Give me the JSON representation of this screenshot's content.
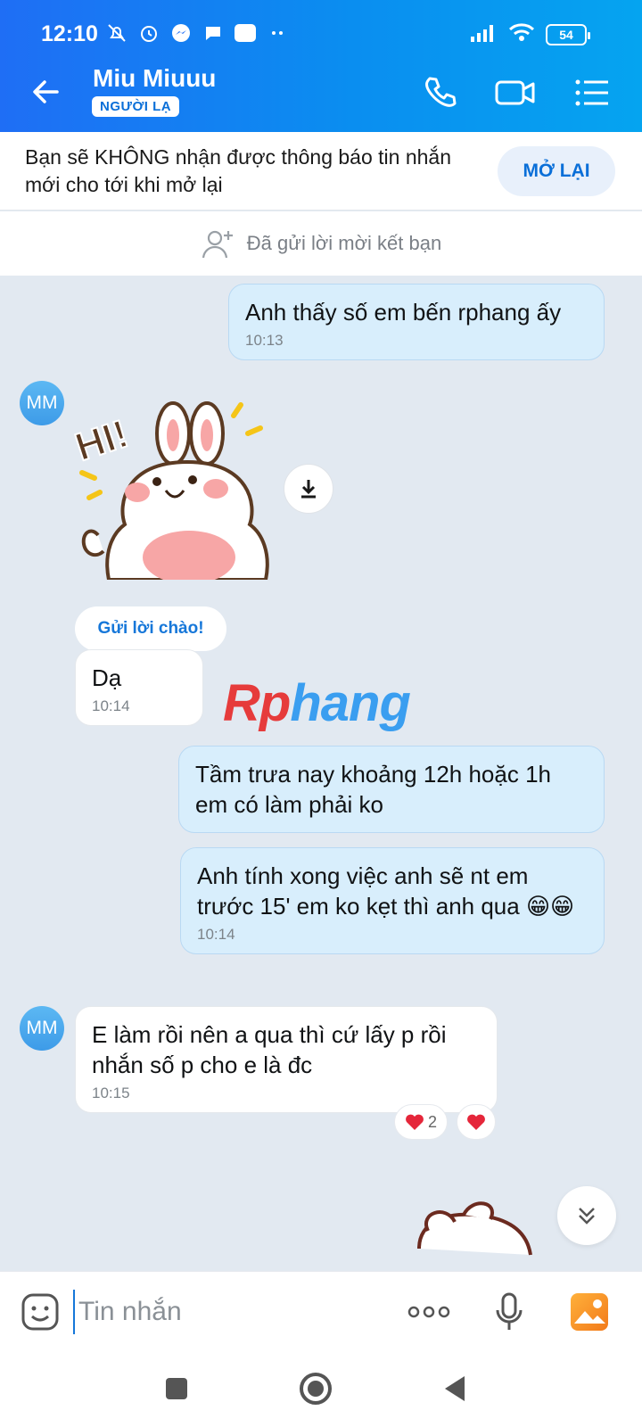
{
  "status_bar": {
    "time": "12:10",
    "battery": "54",
    "app_icon_label": "Zalo"
  },
  "header": {
    "contact_name": "Miu Miuuu",
    "contact_badge": "NGƯỜI LẠ",
    "colors": {
      "gradient_start": "#1f6ef5",
      "gradient_end": "#05a4f0"
    }
  },
  "notice": {
    "text": "Bạn sẽ KHÔNG nhận được thông báo tin nhắn mới cho tới khi mở lại",
    "button": "MỞ LẠI"
  },
  "friend_request": {
    "text": "Đã gửi lời mời kết bạn"
  },
  "chat": {
    "avatar_initials": "MM",
    "greet_button": "Gửi lời chào!",
    "sticker_text": "HI!",
    "watermark": {
      "part1": "Rp",
      "part2": "hang"
    },
    "messages": [
      {
        "direction": "out",
        "text": "Anh thấy số em bến rphang ấy",
        "time": "10:13"
      },
      {
        "direction": "in",
        "text": "Dạ",
        "time": "10:14"
      },
      {
        "direction": "out",
        "text": "Tầm trưa nay khoảng 12h hoặc 1h em có làm phải ko",
        "time": ""
      },
      {
        "direction": "out",
        "text": "Anh tính xong việc anh sẽ nt em trước 15' em ko kẹt thì anh qua 😁😁",
        "time": "10:14"
      },
      {
        "direction": "in",
        "text": "E làm rồi nên a qua thì cứ lấy p rồi nhắn số p cho e là đc",
        "time": "10:15"
      }
    ],
    "reactions": {
      "heart_count": "2"
    }
  },
  "input_bar": {
    "placeholder": "Tin nhắn"
  }
}
